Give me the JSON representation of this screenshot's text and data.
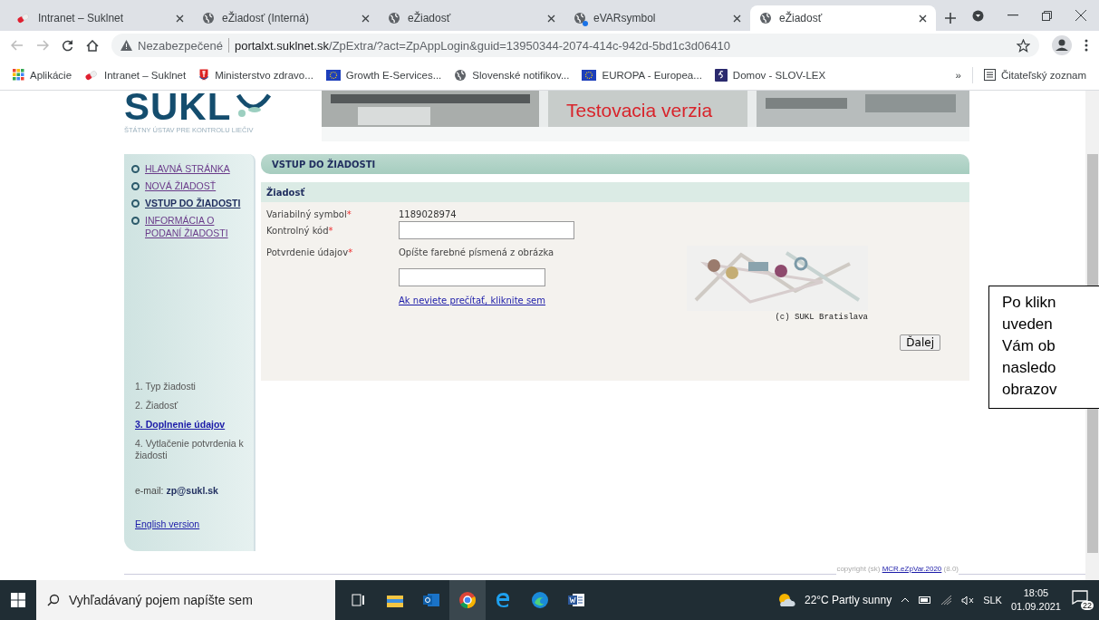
{
  "browser": {
    "tabs": [
      {
        "title": "Intranet – Suklnet",
        "kind": "pill",
        "badge": false,
        "selected": false
      },
      {
        "title": "eŽiadosť (Interná)",
        "kind": "globe",
        "badge": false,
        "selected": false
      },
      {
        "title": "eŽiadosť",
        "kind": "globe",
        "badge": false,
        "selected": false
      },
      {
        "title": "eVARsymbol",
        "kind": "globe",
        "badge": true,
        "selected": false
      },
      {
        "title": "eŽiadosť",
        "kind": "globe",
        "badge": false,
        "selected": true
      }
    ],
    "security": "Nezabezpečené",
    "url_host": "portalxt.suklnet.sk",
    "url_path": "/ZpExtra/?act=ZpAppLogin&guid=13950344-2074-414c-942d-5bd1c3d06410",
    "bookmarks": [
      {
        "label": "Aplikácie",
        "kind": "apps"
      },
      {
        "label": "Intranet – Suklnet",
        "kind": "pill"
      },
      {
        "label": "Ministerstvo zdravo...",
        "kind": "shield"
      },
      {
        "label": "Growth E-Services...",
        "kind": "eu"
      },
      {
        "label": "Slovenské notifikov...",
        "kind": "globe"
      },
      {
        "label": "EUROPA - Europea...",
        "kind": "eu"
      },
      {
        "label": "Domov - SLOV-LEX",
        "kind": "law"
      }
    ],
    "more": "»",
    "reading_list": "Čitateľský zoznam"
  },
  "header": {
    "logo": "SUKL",
    "subtitle": "ŠTÁTNY ÚSTAV PRE KONTROLU LIEČIV",
    "banner_text": "Testovacia verzia"
  },
  "sidebar": {
    "nav": [
      {
        "label": "HLAVNÁ STRÁNKA",
        "selected": false
      },
      {
        "label": "NOVÁ ŽIADOSŤ",
        "selected": false
      },
      {
        "label": "VSTUP DO ŽIADOSTI",
        "selected": true
      },
      {
        "label": "INFORMÁCIA O PODANÍ ŽIADOSTI",
        "selected": false
      }
    ],
    "steps": [
      {
        "label": "1. Typ žiadosti",
        "selected": false
      },
      {
        "label": "2. Žiadosť",
        "selected": false
      },
      {
        "label": "3. Doplnenie údajov",
        "selected": true
      },
      {
        "label": "4. Vytlačenie potvrdenia k žiadosti",
        "selected": false
      }
    ],
    "email": "e-mail: **zp@sukl.sk**",
    "english": "English version"
  },
  "form": {
    "title": "VSTUP DO ŽIADOSTI",
    "section": "Žiadosť",
    "variable_symbol": {
      "label": "Variabilný symbol",
      "mark": "*",
      "value": "1189028974"
    },
    "control_code": {
      "label": "Kontrolný kód",
      "mark": "*"
    },
    "confirmation": {
      "label": "Potvrdenie údajov",
      "mark": "*",
      "hint": "Opíšte farebné písmená z obrázka",
      "help_link": "Ak neviete prečítať, kliknite sem",
      "captcha_credit": "(c) SUKL Bratislava"
    },
    "next_button": "Ďalej"
  },
  "footer": {
    "copyright": "copyright (sk) ",
    "link": "MCR.eZpVar.2020",
    "version": " (8.0)"
  },
  "callout": {
    "lines": [
      "Po klikn",
      "uveden",
      "Vám ob",
      "nasledo",
      "obrazov"
    ]
  },
  "taskbar": {
    "search_placeholder": "Vyhľadávaný pojem napíšte sem",
    "weather": "22°C  Partly sunny",
    "language": "SLK",
    "time": "18:05",
    "date": "01.09.2021",
    "notifications": "22"
  }
}
